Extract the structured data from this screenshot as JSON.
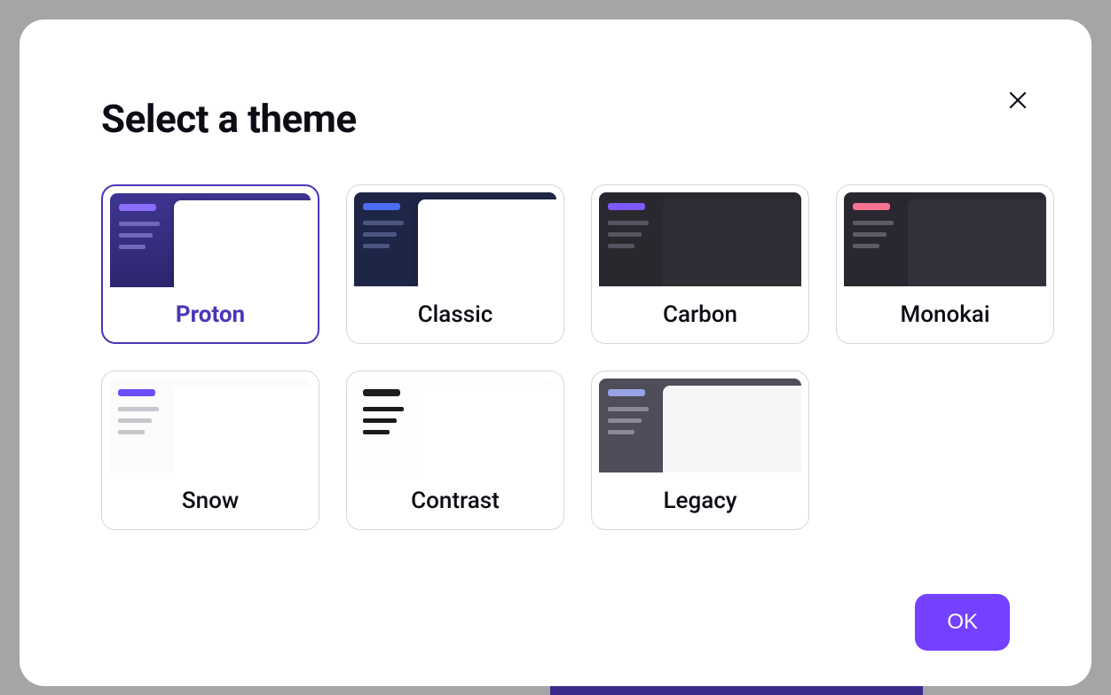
{
  "modal": {
    "title": "Select a theme",
    "ok_label": "OK",
    "close_label": "Close"
  },
  "themes": [
    {
      "id": "proton",
      "label": "Proton",
      "selected": true
    },
    {
      "id": "classic",
      "label": "Classic",
      "selected": false
    },
    {
      "id": "carbon",
      "label": "Carbon",
      "selected": false
    },
    {
      "id": "monokai",
      "label": "Monokai",
      "selected": false
    },
    {
      "id": "snow",
      "label": "Snow",
      "selected": false
    },
    {
      "id": "contrast",
      "label": "Contrast",
      "selected": false
    },
    {
      "id": "legacy",
      "label": "Legacy",
      "selected": false
    }
  ]
}
